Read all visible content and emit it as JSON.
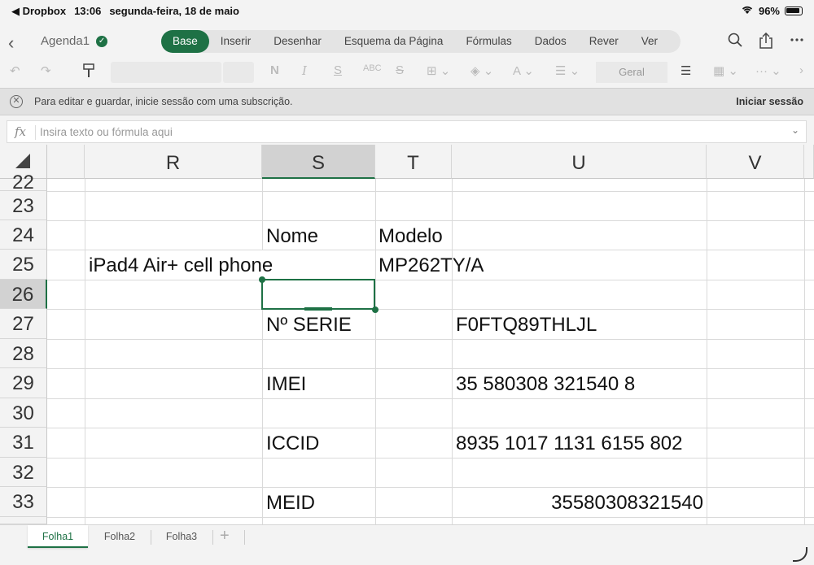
{
  "status": {
    "back_app": "◀ Dropbox",
    "time": "13:06",
    "date": "segunda-feira, 18 de maio",
    "battery": "96%"
  },
  "titlebar": {
    "doc_name": "Agenda1",
    "tabs": [
      "Base",
      "Inserir",
      "Desenhar",
      "Esquema da Página",
      "Fórmulas",
      "Dados",
      "Rever",
      "Ver"
    ],
    "active_tab": "Base"
  },
  "toolbar": {
    "number_format": "Geral"
  },
  "notice": {
    "message": "Para editar e guardar, inicie sessão com uma subscrição.",
    "signin_label": "Iniciar sessão"
  },
  "formula": {
    "fx": "fx",
    "placeholder": "Insira texto ou fórmula aqui"
  },
  "grid": {
    "columns": [
      "R",
      "S",
      "T",
      "U",
      "V"
    ],
    "selected_column": "S",
    "rows": [
      "22",
      "23",
      "24",
      "25",
      "26",
      "27",
      "28",
      "29",
      "30",
      "31",
      "32",
      "33"
    ],
    "selected_row": "26",
    "cells": {
      "S24": "Nome",
      "T24": "Modelo",
      "R25": "iPad4 Air+ cell phone",
      "T25": "MP262TY/A",
      "S27": "Nº SERIE",
      "U27": "F0FTQ89THLJL",
      "S29": "IMEI",
      "U29": "35 580308 321540 8",
      "S31": "ICCID",
      "U31": "8935 1017 1131 6155 802",
      "S33": "MEID",
      "U33": "35580308321540"
    }
  },
  "sheets": {
    "tabs": [
      "Folha1",
      "Folha2",
      "Folha3"
    ],
    "active": "Folha1",
    "add_label": "+"
  }
}
